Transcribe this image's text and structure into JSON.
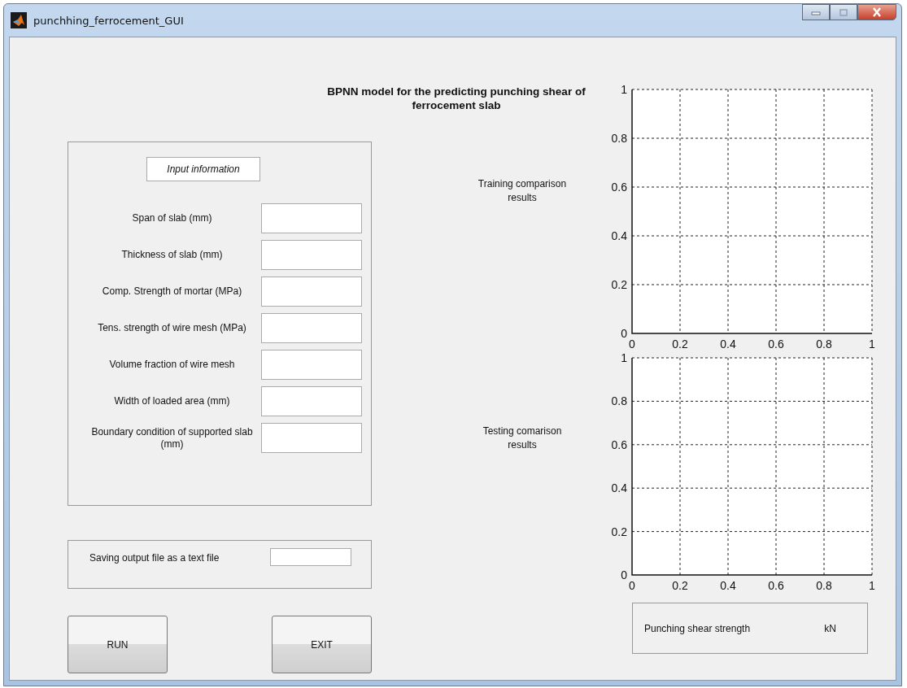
{
  "window": {
    "title": "punchhing_ferrocement_GUI"
  },
  "heading": "BPNN model for the predicting punching shear of ferrocement slab",
  "input_panel": {
    "title": "Input information",
    "fields": [
      {
        "label": "Span of slab (mm)"
      },
      {
        "label": "Thickness of slab (mm)"
      },
      {
        "label": "Comp. Strength of mortar (MPa)"
      },
      {
        "label": "Tens. strength of wire mesh (MPa)"
      },
      {
        "label": "Volume fraction of wire mesh"
      },
      {
        "label": "Width of loaded area (mm)"
      },
      {
        "label": "Boundary condition of supported slab (mm)"
      }
    ]
  },
  "save_panel": {
    "label": "Saving output file as a text file"
  },
  "buttons": [
    "RUN",
    "EXIT"
  ],
  "plots": [
    {
      "label": "Training comparison results",
      "chart_data": {
        "type": "line",
        "grid": true,
        "xlim": [
          0,
          1
        ],
        "ylim": [
          0,
          1
        ],
        "xticks": [
          0,
          0.2,
          0.4,
          0.6,
          0.8,
          1
        ],
        "yticks": [
          0,
          0.2,
          0.4,
          0.6,
          0.8,
          1
        ]
      }
    },
    {
      "label": "Testing comarison results",
      "chart_data": {
        "type": "line",
        "grid": true,
        "xlim": [
          0,
          1
        ],
        "ylim": [
          0,
          1
        ],
        "xticks": [
          0,
          0.2,
          0.4,
          0.6,
          0.8,
          1
        ],
        "yticks": [
          0,
          0.2,
          0.4,
          0.6,
          0.8,
          1
        ]
      }
    }
  ],
  "result_panel": {
    "label": "Punching shear strength",
    "unit": "kN"
  }
}
